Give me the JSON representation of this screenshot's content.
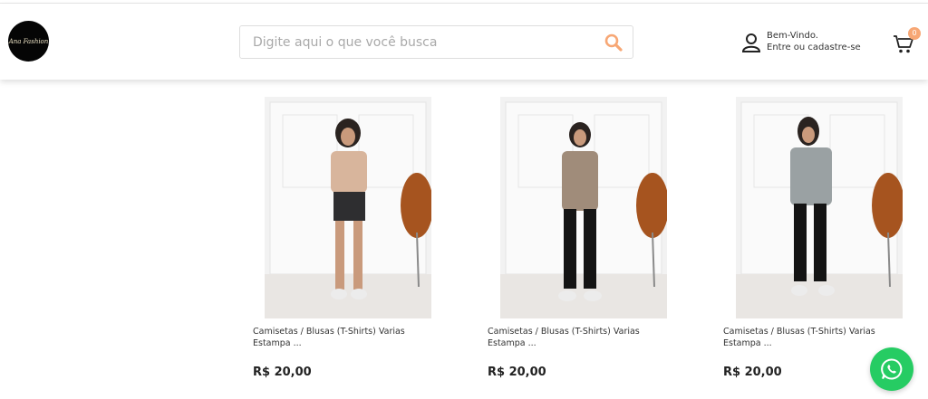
{
  "header": {
    "logo_text": "Ana Fashion",
    "search": {
      "placeholder": "Digite aqui o que você busca",
      "value": ""
    },
    "account": {
      "greeting": "Bem-Vindo.",
      "signup_text": "Entre ou cadastre-se"
    },
    "cart": {
      "count": "0"
    }
  },
  "colors": {
    "accent": "#f7a775",
    "whatsapp": "#26cc63"
  },
  "products": [
    {
      "name": "Camisetas / Blusas (T-Shirts) Varias Estampa ...",
      "price": "R$ 20,00",
      "shirt_color": "#d8b59c",
      "bottom": "shorts"
    },
    {
      "name": "Camisetas / Blusas (T-Shirts) Varias Estampa ...",
      "price": "R$ 20,00",
      "shirt_color": "#a08c7a",
      "bottom": "leggings"
    },
    {
      "name": "Camisetas / Blusas (T-Shirts) Varias Estampa ...",
      "price": "R$ 20,00",
      "shirt_color": "#9aa1a3",
      "bottom": "leggings"
    }
  ],
  "floating": {
    "whatsapp_icon": "whatsapp-icon"
  }
}
